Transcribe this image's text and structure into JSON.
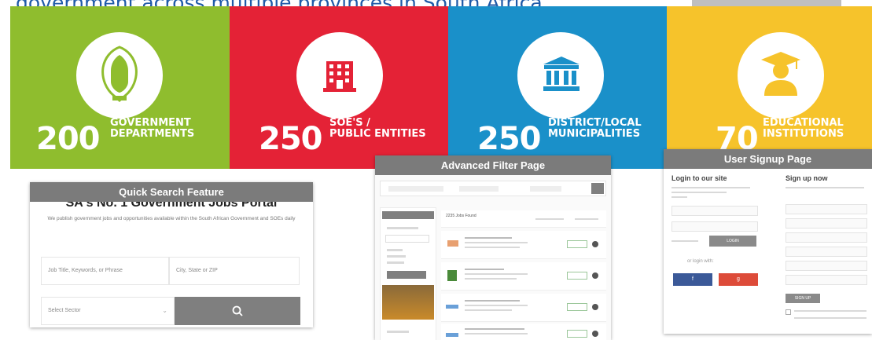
{
  "heading": "government across multiple provinces in South Africa",
  "colors": {
    "green": "#8fbd2e",
    "red": "#e42236",
    "blue": "#1a90c9",
    "yellow": "#f6c32b"
  },
  "stats": [
    {
      "number": "200",
      "line1": "GOVERNMENT",
      "line2": "DEPARTMENTS",
      "icon": "coat-of-arms-icon"
    },
    {
      "number": "250",
      "line1": "SOE'S /",
      "line2": "PUBLIC ENTITIES",
      "icon": "building-icon"
    },
    {
      "number": "250",
      "line1": "DISTRICT/LOCAL",
      "line2": "MUNICIPALITIES",
      "icon": "columns-icon"
    },
    {
      "number": "70",
      "line1": "EDUCATIONAL",
      "line2": "INSTITUTIONS",
      "icon": "graduate-icon"
    }
  ],
  "quick_search": {
    "caption": "Quick Search Feature",
    "title": "SA's No. 1 Government Jobs Portal",
    "subtitle": "We publish government jobs and opportunities available within the South African Government and SOEs daily",
    "keywords_placeholder": "Job Title, Keywords, or Phrase",
    "location_placeholder": "City, State or ZIP",
    "sector_placeholder": "Select Sector",
    "search_icon": "search-icon"
  },
  "advanced_filter": {
    "caption": "Advanced Filter Page",
    "results_title": "2235 Jobs Found"
  },
  "signup": {
    "caption": "User Signup Page",
    "login_title": "Login to our site",
    "signup_title": "Sign up now",
    "login_button": "LOGIN",
    "or_login_with": "or login with:",
    "signup_button": "SIGN UP"
  }
}
